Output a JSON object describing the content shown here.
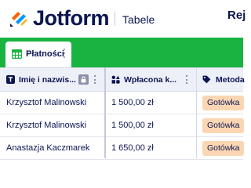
{
  "header": {
    "brand": "Jotform",
    "product": "Tabele",
    "right_link": "Rej"
  },
  "tabs": [
    {
      "label": "Płatności",
      "icon": "table-grid-icon",
      "active": true
    }
  ],
  "table": {
    "columns": [
      {
        "label": "Imię i nazwis...",
        "icon": "text-type-icon",
        "locked": true
      },
      {
        "label": "Wpłacona k...",
        "icon": "shapes-icon"
      },
      {
        "label": "Metoda",
        "icon": "tag-icon"
      }
    ],
    "rows": [
      {
        "name": "Krzysztof Malinowski",
        "amount": "1 500,00 zł",
        "method": "Gotówka"
      },
      {
        "name": "Krzysztof Malinowski",
        "amount": "1 500,00 zł",
        "method": "Gotówka"
      },
      {
        "name": "Anastazja Kaczmarek",
        "amount": "1 650,00 zł",
        "method": "Gotówka"
      }
    ]
  },
  "colors": {
    "brand_navy": "#0a1551",
    "tab_bar_green": "#18b340",
    "header_bg": "#eef0f8",
    "tag_bg": "#fbd6b2"
  }
}
